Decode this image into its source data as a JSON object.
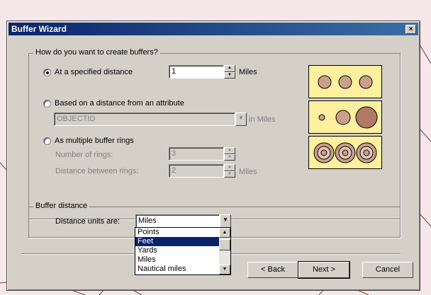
{
  "window": {
    "title": "Buffer Wizard",
    "close_glyph": "×"
  },
  "group1": {
    "legend": "How do you want to create buffers?",
    "opt_distance": {
      "label": "At a specified distance",
      "value": "1",
      "unit": "Miles"
    },
    "opt_attribute": {
      "label": "Based on a distance from an attribute",
      "field_value": "OBJECTID",
      "unit": "in Miles"
    },
    "opt_rings": {
      "label": "As multiple buffer rings",
      "num_rings_label": "Number of rings:",
      "num_rings_value": "3",
      "distance_label": "Distance between rings:",
      "distance_value": "2",
      "unit": "Miles"
    }
  },
  "group2": {
    "legend": "Buffer distance",
    "units_label": "Distance units are:",
    "units_value": "Miles",
    "options": [
      "Points",
      "Feet",
      "Yards",
      "Miles",
      "Nautical miles"
    ],
    "selected_option": "Feet"
  },
  "buttons": {
    "back": "< Back",
    "next": "Next >",
    "cancel": "Cancel"
  },
  "colors": {
    "preview_fill": "#fff0a0",
    "circle_fill": "#c9a08a",
    "title_bar": "#0a246a",
    "selection": "#0a246a"
  }
}
